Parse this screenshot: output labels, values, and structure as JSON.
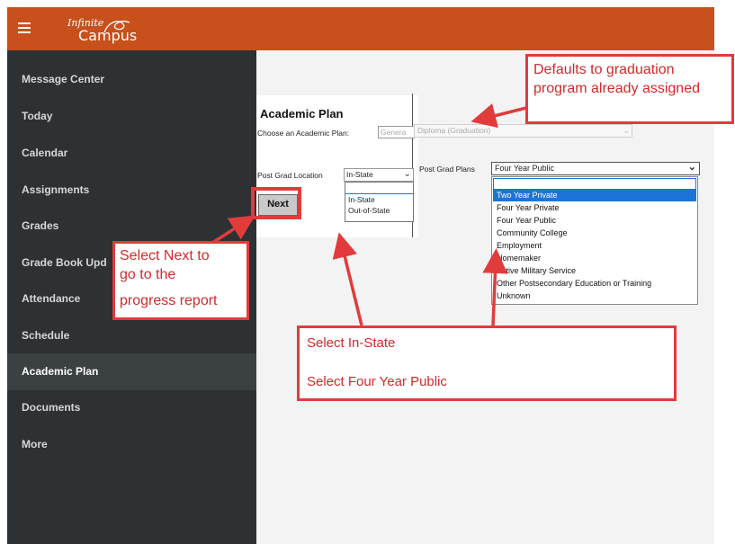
{
  "app": {
    "logo_line1": "Infinite",
    "logo_line2": "Campus"
  },
  "sidebar": {
    "items": [
      {
        "label": "Message Center"
      },
      {
        "label": "Today"
      },
      {
        "label": "Calendar"
      },
      {
        "label": "Assignments"
      },
      {
        "label": "Grades"
      },
      {
        "label": "Grade Book Upd"
      },
      {
        "label": "Attendance"
      },
      {
        "label": "Schedule"
      },
      {
        "label": "Academic Plan"
      },
      {
        "label": "Documents"
      },
      {
        "label": "More"
      }
    ],
    "active": "Academic Plan"
  },
  "main": {
    "title": "Academic Plan",
    "choose_label": "Choose an Academic Plan:",
    "choose_value": "Genera",
    "diploma_value": "Diploma (Graduation)",
    "post_grad_location_label": "Post Grad Location",
    "post_grad_location_value": "In-State",
    "location_options": [
      "",
      "In-State",
      "Out-of-State"
    ],
    "post_grad_plans_label": "Post Grad Plans",
    "post_grad_plans_value": "Four Year Public",
    "plan_options": [
      "",
      "Two Year Private",
      "Four Year Private",
      "Four Year Public",
      "Community College",
      "Employment",
      "Homemaker",
      "Active Military Service",
      "Other Postsecondary Education or Training",
      "Unknown"
    ],
    "highlighted_plan": "Two Year Private",
    "next_label": "Next"
  },
  "callouts": {
    "graduation_line1": "Defaults to graduation",
    "graduation_line2": "program already assigned",
    "next_line1": "Select Next to",
    "next_line2": "go to the",
    "next_line3": "progress report",
    "select_line1": "Select In-State",
    "select_line2": "Select Four Year Public"
  },
  "colors": {
    "header": "#c7501c",
    "sidebar": "#2d3133",
    "callout_border": "#e23b3b",
    "callout_text": "#d12a2a",
    "highlight": "#1e74d6"
  }
}
